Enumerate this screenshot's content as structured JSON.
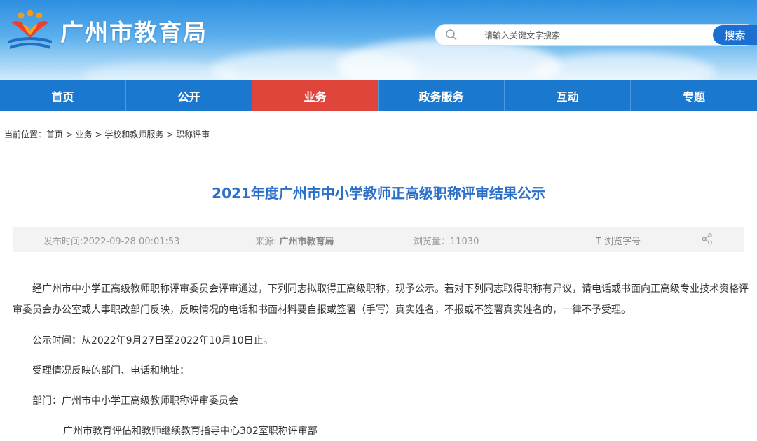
{
  "header": {
    "site_title": "广州市教育局",
    "search_placeholder": "请输入关键文字搜索",
    "search_button": "搜索"
  },
  "nav": {
    "items": [
      {
        "label": "首页"
      },
      {
        "label": "公开"
      },
      {
        "label": "业务"
      },
      {
        "label": "政务服务"
      },
      {
        "label": "互动"
      },
      {
        "label": "专题"
      }
    ],
    "active_index": 2,
    "colors": {
      "bar": "#1a78cf",
      "active": "#e0453c"
    }
  },
  "breadcrumb": {
    "prefix": "当前位置：",
    "items": [
      "首页",
      "业务",
      "学校和教师服务",
      "职称评审"
    ],
    "separator": " > "
  },
  "article": {
    "title": "2021年度广州市中小学教师正高级职称评审结果公示",
    "meta": {
      "publish": "发布时间:2022-09-28 00:01:53",
      "source_label": "来源: ",
      "source_value": "广州市教育局",
      "views": "浏览量：11030",
      "font_size": "T  浏览字号"
    },
    "paragraphs": [
      "经广州市中小学正高级教师职称评审委员会评审通过，下列同志拟取得正高级职称，现予公示。若对下列同志取得职称有异议，请电话或书面向正高级专业技术资格评审委员会办公室或人事职改部门反映，反映情况的电话和书面材料要自报或签署（手写）真实姓名，不报或不签署真实姓名的，一律不予受理。",
      "公示时间：从2022年9月27日至2022年10月10日止。",
      "受理情况反映的部门、电话和地址：",
      "部门：广州市中小学正高级教师职称评审委员会",
      "广州市教育评估和教师继续教育指导中心302室职称评审部"
    ]
  }
}
